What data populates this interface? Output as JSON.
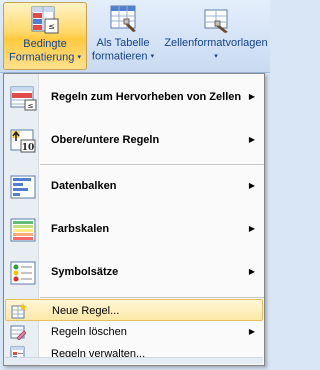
{
  "ribbon": {
    "buttons": [
      {
        "line1": "Bedingte",
        "line2": "Formatierung",
        "icon": "conditional-format-icon"
      },
      {
        "line1": "Als Tabelle",
        "line2": "formatieren",
        "icon": "table-format-icon"
      },
      {
        "line1": "Zellenformatvorlagen",
        "line2": "",
        "icon": "cell-styles-icon"
      }
    ],
    "dropdown_glyph": "▾"
  },
  "menu": {
    "items": [
      {
        "label": "Regeln zum Hervorheben von Zellen",
        "icon": "highlight-cells-rules-icon",
        "submenu": true
      },
      {
        "label": "Obere/untere Regeln",
        "icon": "top-bottom-rules-icon",
        "icon_text": "10",
        "submenu": true
      },
      {
        "label": "Datenbalken",
        "icon": "data-bars-icon",
        "submenu": true
      },
      {
        "label": "Farbskalen",
        "icon": "color-scales-icon",
        "submenu": true
      },
      {
        "label": "Symbolsätze",
        "icon": "icon-sets-icon",
        "submenu": true
      },
      {
        "label": "Neue Regel...",
        "icon": "new-rule-icon",
        "submenu": false,
        "highlighted": true
      },
      {
        "label": "Regeln löschen",
        "icon": "clear-rules-icon",
        "submenu": true
      },
      {
        "label": "Regeln verwalten...",
        "icon": "manage-rules-icon",
        "submenu": false
      }
    ],
    "submenu_glyph": "▶"
  },
  "colors": {
    "highlight": "#ffe9a8",
    "ribbon_text": "#15428b",
    "selected_button": "#ffd867"
  }
}
